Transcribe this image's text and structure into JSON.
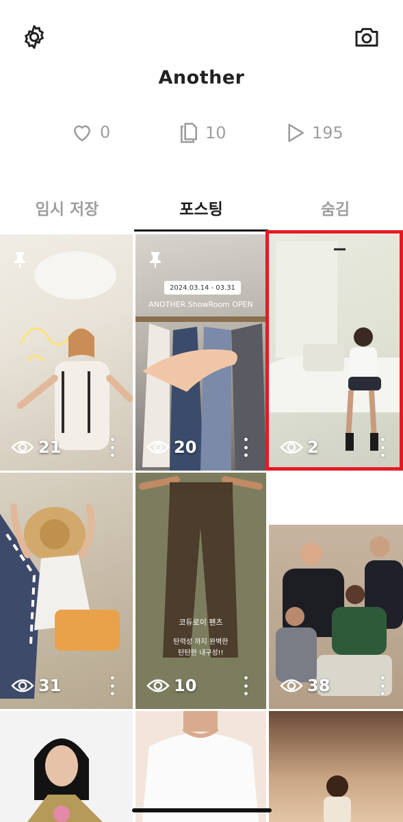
{
  "header": {
    "settings_icon": "gear-icon",
    "camera_icon": "camera-icon",
    "title": "Another"
  },
  "stats": {
    "likes": "0",
    "posts": "10",
    "plays": "195"
  },
  "tabs": [
    {
      "label": "임시 저장"
    },
    {
      "label": "포스팅"
    },
    {
      "label": "숨김"
    }
  ],
  "posts": [
    {
      "views": "21",
      "pinned": true
    },
    {
      "views": "20",
      "pinned": true,
      "overlay_date": "2024.03.14 - 03.31",
      "overlay_text": "ANOTHER ShowRoom OPEN"
    },
    {
      "views": "2",
      "selected": true
    },
    {
      "views": "31"
    },
    {
      "views": "10",
      "overlay_line1": "코듀로이 팬츠",
      "overlay_line2": "탄력성 까지 완벽한",
      "overlay_line3": "탄탄한 내구성!!"
    },
    {
      "views": "38"
    }
  ],
  "colors": {
    "accent": "#e31b23",
    "muted": "#9e9e9e",
    "text": "#222222"
  }
}
